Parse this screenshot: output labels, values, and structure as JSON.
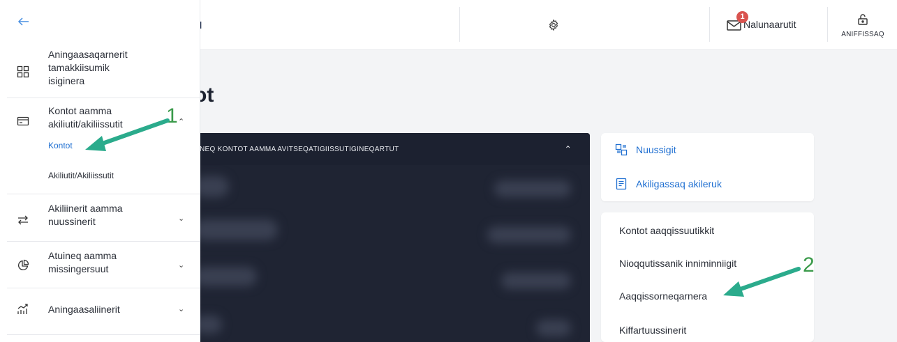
{
  "topbar": {
    "brand": "EN",
    "inbox_badge": "1",
    "inbox_label": "Nalunaarutit",
    "logout_label": "ANIFFISSAQ"
  },
  "page": {
    "title": "tot"
  },
  "dark_panel": {
    "header": "NEQ KONTOT AAMMA AVITSEQATIGIISSUTIGINEQARTUT"
  },
  "quick_links": [
    {
      "label": "Nuussigit",
      "icon": "transfer-doc-icon"
    },
    {
      "label": "Akiligassaq akileruk",
      "icon": "bill-icon"
    }
  ],
  "account_menu": [
    "Kontot aaqqissuutikkit",
    "Nioqqutissanik inniminniigit",
    "Aaqqissorneqarnera",
    "Kiffartuussinerit"
  ],
  "sidebar": {
    "items": [
      {
        "label": "Aningaasaqarnerit tamakkiisumik isiginera",
        "icon": "dashboard-icon"
      },
      {
        "label": "Kontot aamma akiliutit/akiliissutit",
        "icon": "card-icon",
        "sub": [
          "Kontot",
          "Akiliutit/Akiliissutit"
        ]
      },
      {
        "label": "Akiliinerit aamma nuussinerit",
        "icon": "transfer-icon"
      },
      {
        "label": "Atuineq aamma missingersuut",
        "icon": "pie-chart-icon"
      },
      {
        "label": "Aningaasaliinerit",
        "icon": "growth-chart-icon"
      }
    ]
  },
  "annotations": [
    "1",
    "2"
  ],
  "colors": {
    "accent": "#1f6fd1",
    "badge": "#d9534f",
    "annotation": "#3a9a4a",
    "panel": "#1f2433"
  }
}
